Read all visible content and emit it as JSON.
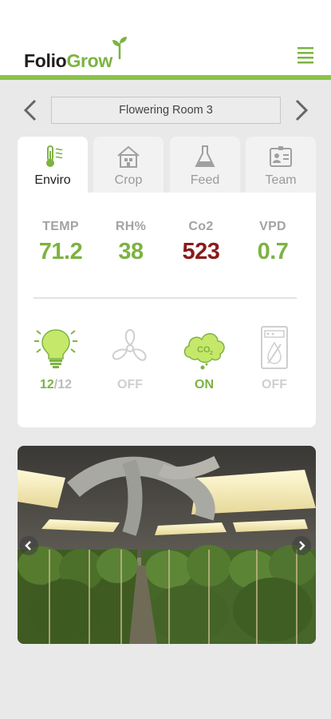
{
  "app": {
    "logo_part1": "Folio",
    "logo_part2": "Grow"
  },
  "header": {
    "menu_icon": "hamburger-menu-icon"
  },
  "room_nav": {
    "room_name": "Flowering Room 3",
    "prev_icon": "chevron-left-icon",
    "next_icon": "chevron-right-icon"
  },
  "tabs": [
    {
      "label": "Enviro",
      "icon": "thermometer-icon",
      "active": true
    },
    {
      "label": "Crop",
      "icon": "greenhouse-icon",
      "active": false
    },
    {
      "label": "Feed",
      "icon": "flask-icon",
      "active": false
    },
    {
      "label": "Team",
      "icon": "id-badge-icon",
      "active": false
    }
  ],
  "stats": [
    {
      "label": "TEMP",
      "value": "71.2",
      "color": "#7cb342"
    },
    {
      "label": "RH%",
      "value": "38",
      "color": "#7cb342"
    },
    {
      "label": "Co2",
      "value": "523",
      "color": "#8b1a1a"
    },
    {
      "label": "VPD",
      "value": "0.7",
      "color": "#7cb342"
    }
  ],
  "controls": {
    "light": {
      "icon": "light-bulb-icon",
      "ratio_on": "12",
      "ratio_sep": "/",
      "ratio_off": "12"
    },
    "fan": {
      "icon": "fan-icon",
      "state": "OFF"
    },
    "co2": {
      "icon": "co2-cloud-icon",
      "icon_text": "CO",
      "icon_sub": "2",
      "state": "ON"
    },
    "dehumidifier": {
      "icon": "dehumidifier-icon",
      "state": "OFF"
    }
  },
  "photo": {
    "prev_icon": "chevron-left-icon",
    "next_icon": "chevron-right-icon"
  },
  "colors": {
    "accent": "#8bc34a",
    "brand_green": "#7cb342",
    "alert_red": "#8b1a1a",
    "inactive": "#cfcfcf"
  }
}
